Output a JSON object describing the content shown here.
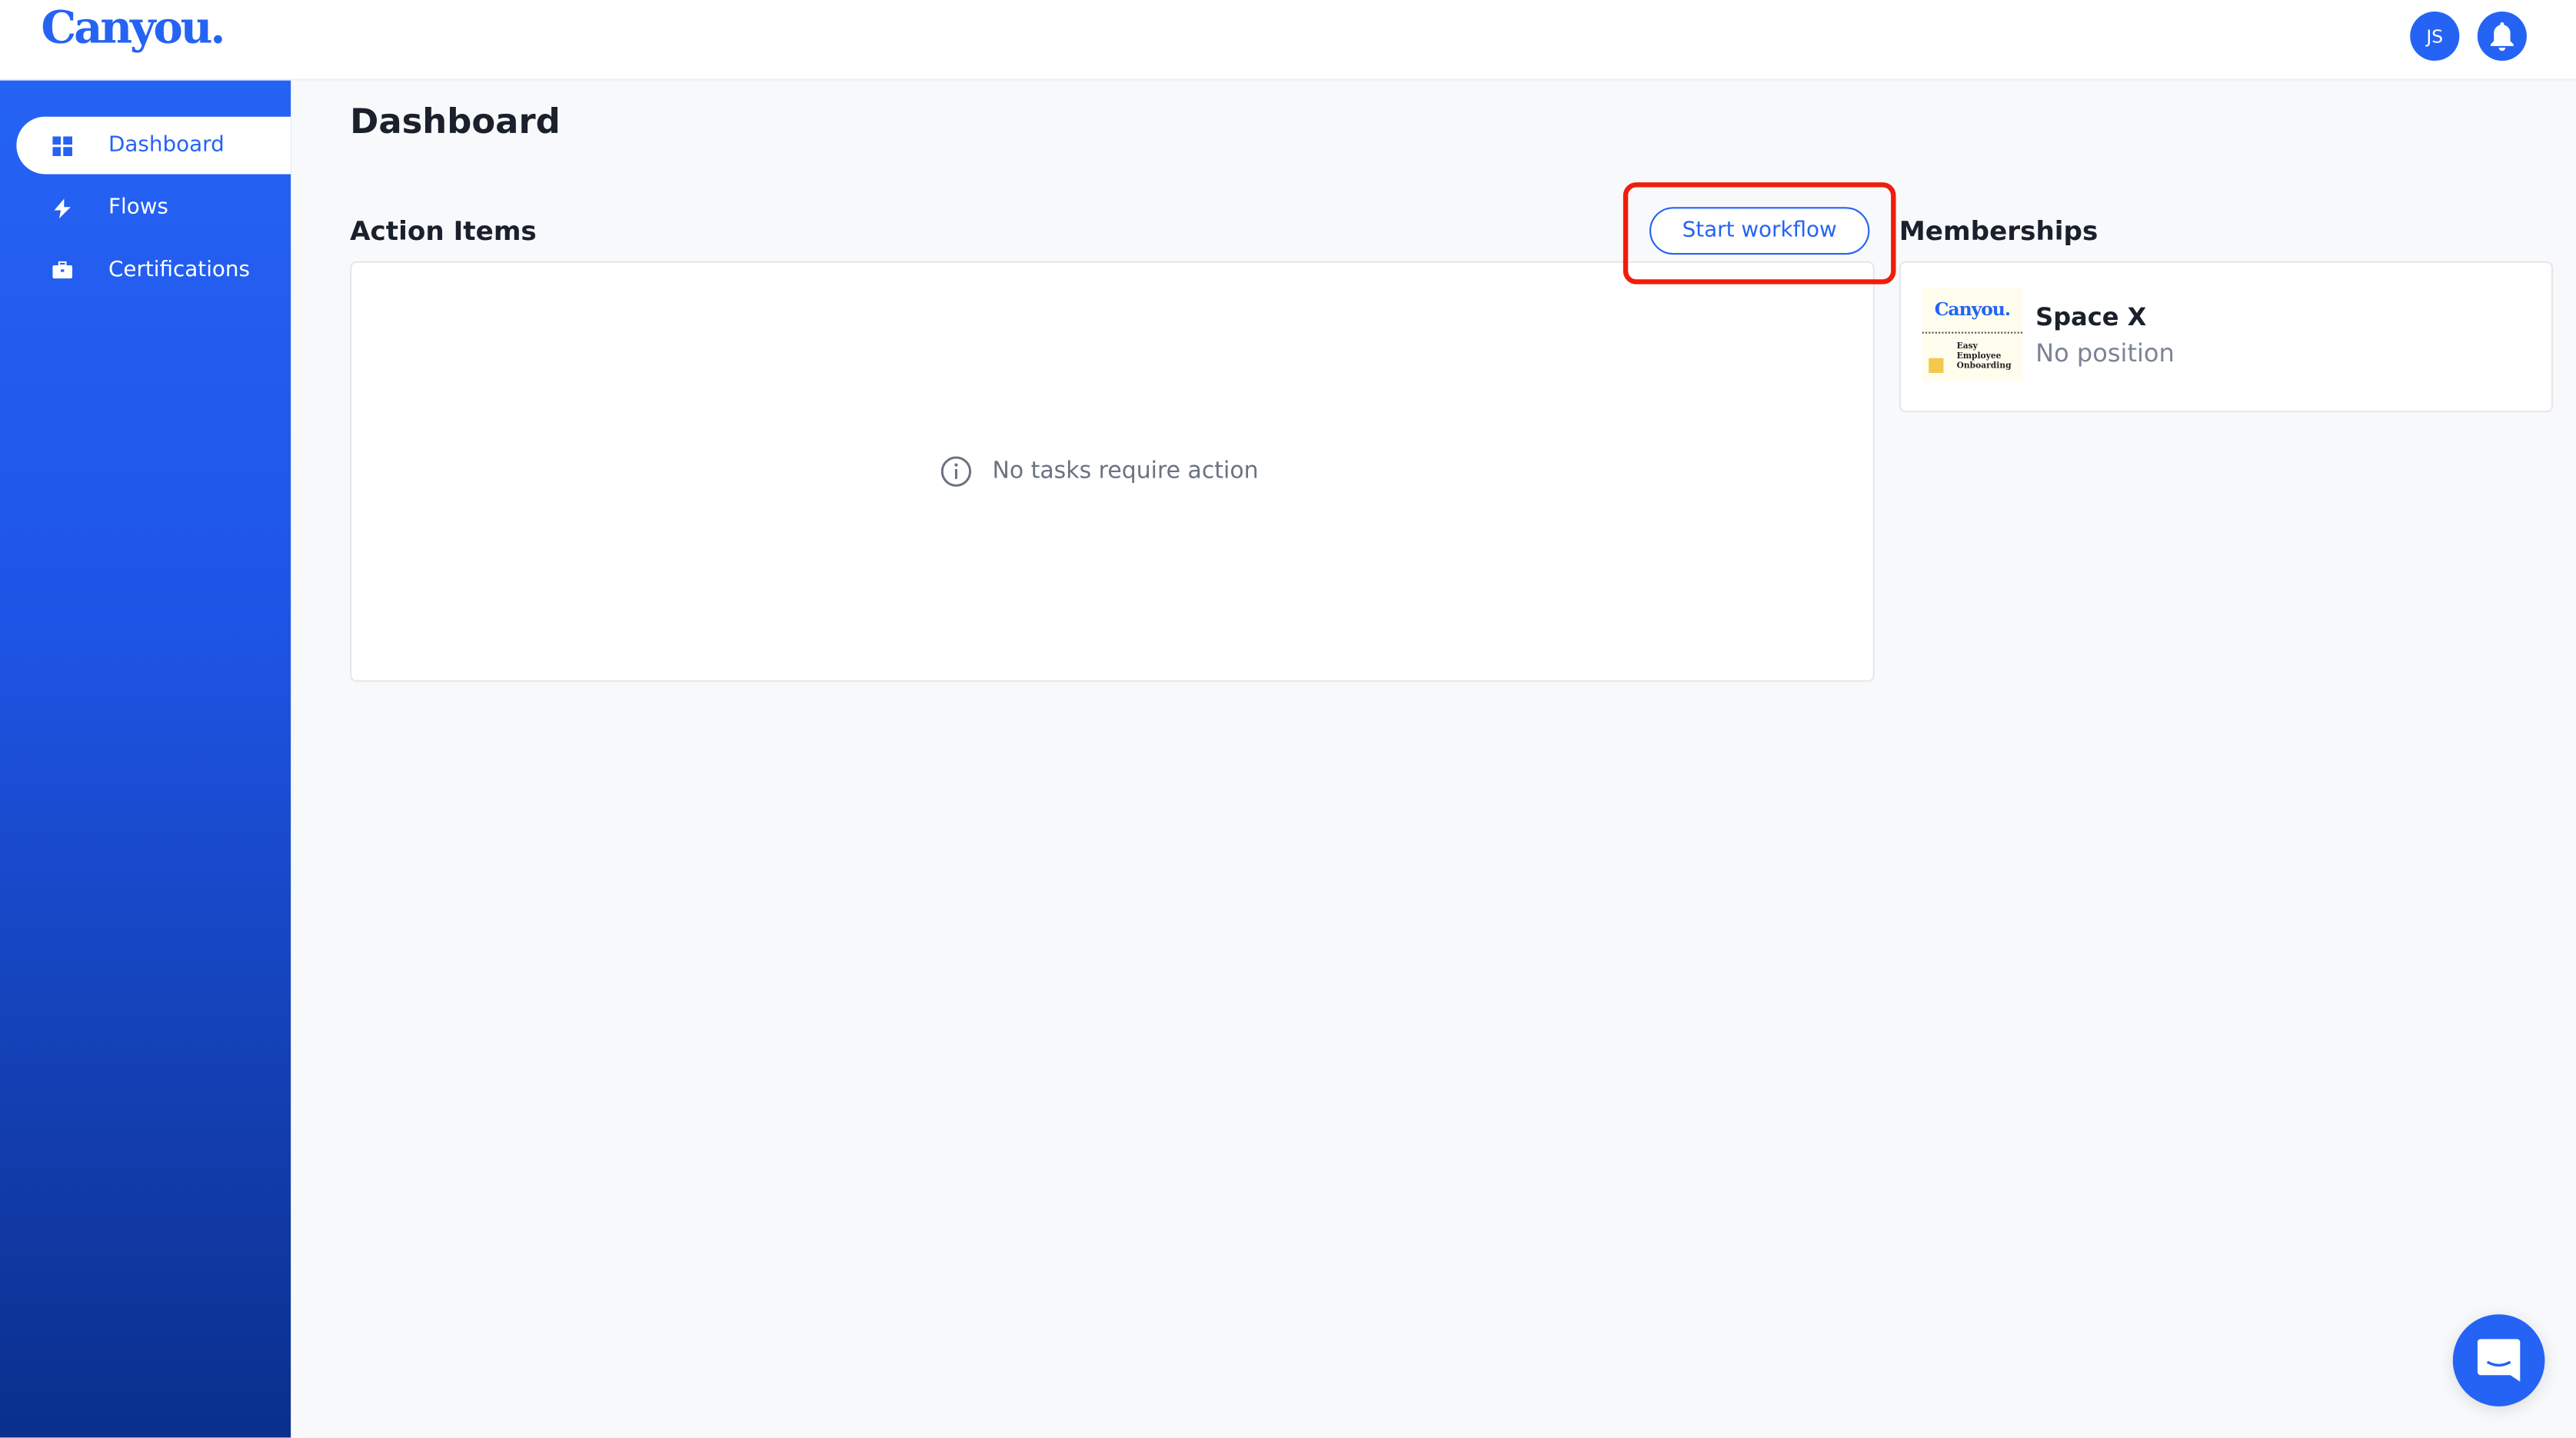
{
  "app": {
    "logo": "Canyou."
  },
  "header": {
    "avatar_initials": "JS",
    "notification_icon": "bell-icon"
  },
  "sidebar": {
    "items": [
      {
        "label": "Dashboard",
        "icon": "dashboard-icon",
        "active": true
      },
      {
        "label": "Flows",
        "icon": "lightning-icon",
        "active": false
      },
      {
        "label": "Certifications",
        "icon": "briefcase-icon",
        "active": false
      }
    ]
  },
  "main": {
    "title": "Dashboard",
    "action_items": {
      "heading": "Action Items",
      "start_workflow_label": "Start workflow",
      "empty_message": "No tasks require action"
    },
    "memberships": {
      "heading": "Memberships",
      "items": [
        {
          "name": "Space X",
          "position": "No position",
          "logo_title": "Canyou.",
          "logo_tagline": "Easy Employee Onboarding"
        }
      ]
    }
  },
  "colors": {
    "accent": "#2563f5",
    "highlight": "#f01d0c"
  }
}
